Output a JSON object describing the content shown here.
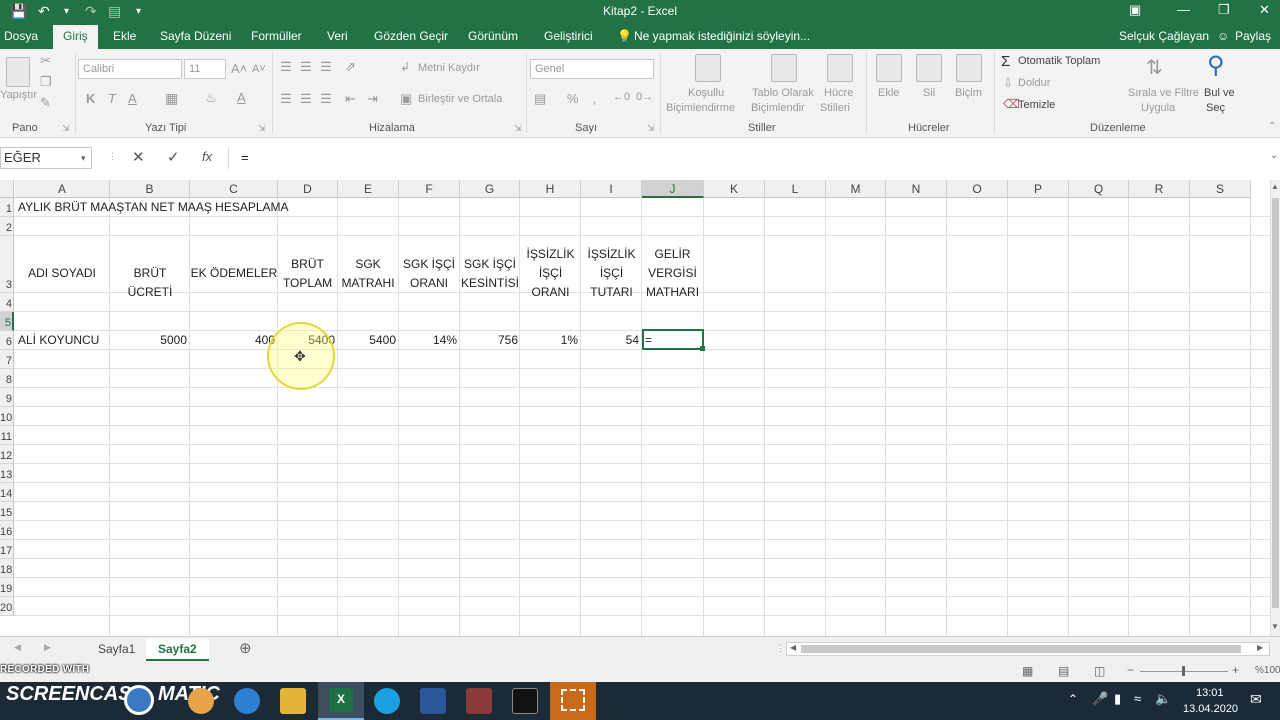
{
  "window": {
    "title": "Kitap2 - Excel",
    "user": "Selçuk Çağlayan",
    "share": "Paylaş"
  },
  "tabs": [
    "Dosya",
    "Giriş",
    "Ekle",
    "Sayfa Düzeni",
    "Formüller",
    "Veri",
    "Gözden Geçir",
    "Görünüm",
    "Geliştirici"
  ],
  "tell_me": "Ne yapmak istediğinizi söyleyin...",
  "ribbon": {
    "paste": "Yapıştır",
    "font_name": "Calibri",
    "font_size": "11",
    "bold": "K",
    "italic": "T",
    "underline": "A",
    "wrap_text": "Metni Kaydır",
    "merge_center": "Birleştir ve Ortala",
    "number_format": "Genel",
    "percent": "%",
    "conditional": [
      "Koşullu",
      "Biçimlendirme"
    ],
    "format_table": [
      "Tablo Olarak",
      "Biçimlendir"
    ],
    "cell_styles": [
      "Hücre",
      "Stilleri"
    ],
    "insert": "Ekle",
    "delete": "Sil",
    "format": "Biçim",
    "autosum": "Otomatik Toplam",
    "fill": "Doldur",
    "clear": "Temizle",
    "sort_filter": [
      "Sırala ve Filtre",
      "Uygula"
    ],
    "find_select": [
      "Bul ve",
      "Seç"
    ],
    "groups": [
      "Pano",
      "Yazı Tipi",
      "Hizalama",
      "Sayı",
      "Stiller",
      "Hücreler",
      "Düzenleme"
    ]
  },
  "formula_bar": {
    "name_box": "EĞER",
    "fx": "fx",
    "value": "="
  },
  "columns": [
    "A",
    "B",
    "C",
    "D",
    "E",
    "F",
    "G",
    "H",
    "I",
    "J",
    "K",
    "L",
    "M",
    "N",
    "O",
    "P",
    "Q",
    "R",
    "S"
  ],
  "rows": [
    "1",
    "2",
    "3",
    "4",
    "5",
    "6",
    "7",
    "8",
    "9",
    "10",
    "11",
    "12",
    "13",
    "14",
    "15",
    "16",
    "17",
    "18",
    "19",
    "20"
  ],
  "sheet": {
    "title": "AYLIK BRÜT MAAŞTAN NET MAAŞ HESAPLAMA",
    "headers": [
      "ADI SOYADI",
      "BRÜT ÜCRETİ",
      "EK ÖDEMELER",
      "BRÜT\nTOPLAM",
      "SGK\nMATRAHI",
      "SGK İŞÇİ\nORANI",
      "SGK İŞÇİ\nKESİNTİSİ",
      "İŞSİZLİK\nİŞÇİ\nORANI",
      "İŞSİZLİK\nİŞÇİ\nTUTARI",
      "GELİR\nVERGİSİ\nMATHARI"
    ],
    "row5": [
      "ALİ KOYUNCU",
      "5000",
      "400",
      "5400",
      "5400",
      "14%",
      "756",
      "1%",
      "54",
      "="
    ]
  },
  "sheet_tabs": [
    "Sayfa1",
    "Sayfa2"
  ],
  "status": {
    "zoom": "%100"
  },
  "watermark": {
    "line1": "RECORDED WITH",
    "line2": "SCREENCAST",
    "line3": "MATIC"
  },
  "clock": {
    "time": "13:01",
    "date": "13.04.2020"
  },
  "colors": {
    "excel_green": "#217346",
    "taskbar": "#1c2a38"
  }
}
